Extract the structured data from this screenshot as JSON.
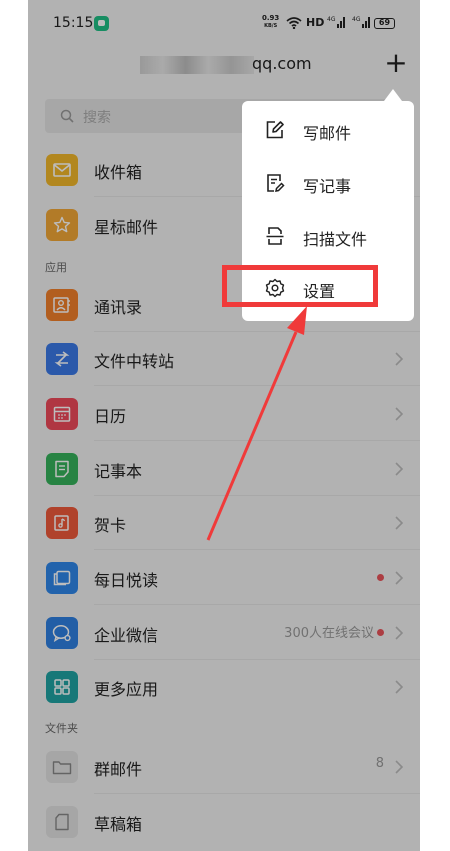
{
  "status_bar": {
    "time": "15:15",
    "net_speed_value": "0.93",
    "net_speed_unit": "KB/S",
    "hd": "HD",
    "battery": "69"
  },
  "header": {
    "account_domain": "qq.com",
    "plus_label": "+"
  },
  "search": {
    "placeholder": "搜索"
  },
  "folders_top": [
    {
      "label": "收件箱",
      "icon": "inbox-icon",
      "color": "#f1b62b"
    },
    {
      "label": "星标邮件",
      "icon": "star-icon",
      "color": "#f0a636"
    }
  ],
  "apps_section": {
    "title": "应用",
    "items": [
      {
        "label": "通讯录",
        "icon": "contacts-icon",
        "color": "#f07f2a"
      },
      {
        "label": "文件中转站",
        "icon": "transfer-icon",
        "color": "#3a78e6"
      },
      {
        "label": "日历",
        "icon": "calendar-icon",
        "color": "#ee4a5a"
      },
      {
        "label": "记事本",
        "icon": "notepad-icon",
        "color": "#35b15b"
      },
      {
        "label": "贺卡",
        "icon": "greeting-card-icon",
        "color": "#ee5a3a"
      },
      {
        "label": "每日悦读",
        "icon": "reading-icon",
        "color": "#2f86e8"
      },
      {
        "label": "企业微信",
        "icon": "wecom-icon",
        "color": "#2f7fe0",
        "meta": "300人在线会议"
      },
      {
        "label": "更多应用",
        "icon": "more-apps-icon",
        "color": "#1fa3a3"
      }
    ]
  },
  "folders_section": {
    "title": "文件夹",
    "items": [
      {
        "label": "群邮件",
        "icon": "group-mail-icon",
        "count": "8"
      },
      {
        "label": "草稿箱",
        "icon": "drafts-icon"
      }
    ]
  },
  "popup_menu": [
    {
      "label": "写邮件",
      "icon": "compose-icon"
    },
    {
      "label": "写记事",
      "icon": "write-note-icon"
    },
    {
      "label": "扫描文件",
      "icon": "scan-icon"
    },
    {
      "label": "设置",
      "icon": "settings-icon"
    }
  ],
  "colors": {
    "highlight": "#f03a3a",
    "accent_dot": "#e9535a"
  }
}
